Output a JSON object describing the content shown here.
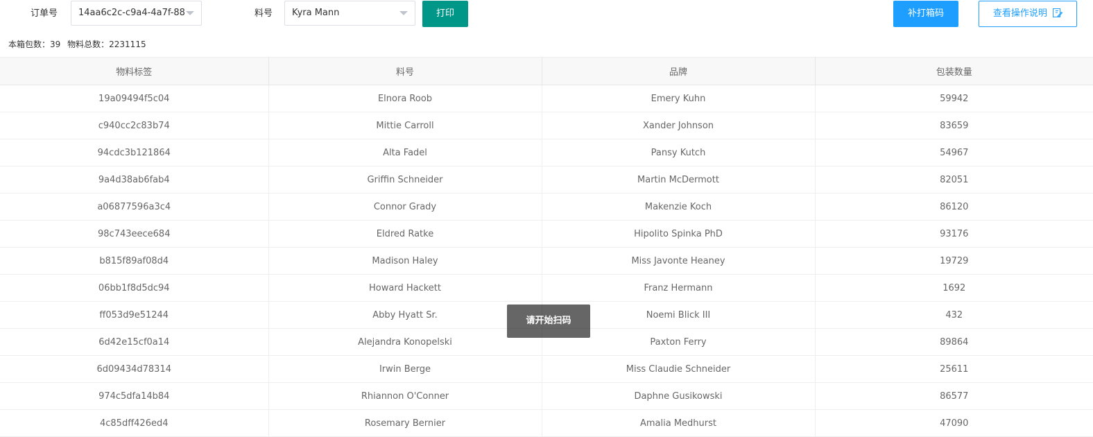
{
  "toolbar": {
    "order_label": "订单号",
    "order_value": "14aa6c2c-c9a4-4a7f-88",
    "part_label": "料号",
    "part_value": "Kyra Mann",
    "print_label": "打印",
    "reprint_label": "补打箱码",
    "help_label": "查看操作说明"
  },
  "summary": {
    "box_count_label": "本箱包数：",
    "box_count": "39",
    "material_total_label": "物料总数：",
    "material_total": "2231115"
  },
  "table": {
    "headers": [
      "物料标签",
      "料号",
      "品牌",
      "包装数量"
    ],
    "rows": [
      [
        "19a09494f5c04",
        "Elnora Roob",
        "Emery Kuhn",
        "59942"
      ],
      [
        "c940cc2c83b74",
        "Mittie Carroll",
        "Xander Johnson",
        "83659"
      ],
      [
        "94cdc3b121864",
        "Alta Fadel",
        "Pansy Kutch",
        "54967"
      ],
      [
        "9a4d38ab6fab4",
        "Griffin Schneider",
        "Martin McDermott",
        "82051"
      ],
      [
        "a06877596a3c4",
        "Connor Grady",
        "Makenzie Koch",
        "86120"
      ],
      [
        "98c743eece684",
        "Eldred Ratke",
        "Hipolito Spinka PhD",
        "93176"
      ],
      [
        "b815f89af08d4",
        "Madison Haley",
        "Miss Javonte Heaney",
        "19729"
      ],
      [
        "06bb1f8d5dc94",
        "Howard Hackett",
        "Franz Hermann",
        "1692"
      ],
      [
        "ff053d9e51244",
        "Abby Hyatt Sr.",
        "Noemi Blick III",
        "432"
      ],
      [
        "6d42e15cf0a14",
        "Alejandra Konopelski",
        "Paxton Ferry",
        "89864"
      ],
      [
        "6d09434d78314",
        "Irwin Berge",
        "Miss Claudie Schneider",
        "25611"
      ],
      [
        "974c5dfa14b84",
        "Rhiannon O'Conner",
        "Daphne Gusikowski",
        "86577"
      ],
      [
        "4c85dff426ed4",
        "Rosemary Bernier",
        "Amalia Medhurst",
        "47090"
      ]
    ]
  },
  "toast": {
    "message": "请开始扫码"
  },
  "colors": {
    "print_button": "#009688",
    "reprint_button": "#1e9fff",
    "help_button_border": "#1e9fff"
  }
}
